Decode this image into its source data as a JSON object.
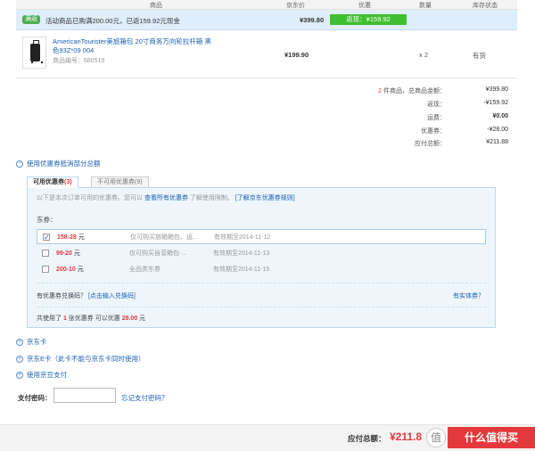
{
  "header": {
    "col_product": "商品",
    "col_jd_price": "京东价",
    "col_discount": "优惠",
    "col_qty": "数量",
    "col_stock": "库存状态"
  },
  "promo": {
    "badge": "满返",
    "text": "活动商品已购满200.00元，已返159.92元现金",
    "price": "¥399.80",
    "rebate_label": "返现：¥159.92"
  },
  "product": {
    "name": "AmericanTourister美旅箱包 20寸商务万向轮拉杆箱 黑色93Z*09 004",
    "code_label": "商品编号：",
    "code": "680515",
    "price": "¥199.90",
    "qty": "x 2",
    "stock": "有货"
  },
  "summary": {
    "count": "2",
    "count_label": " 件商品，总商品金额：",
    "total_goods": "¥399.80",
    "rebate_label": "返现：",
    "rebate": "-¥159.92",
    "shipping_label": "运费：",
    "shipping": "¥0.00",
    "coupon_label": "优惠券：",
    "coupon": "-¥28.00",
    "due_label": "应付总额：",
    "due": "¥211.88"
  },
  "coupon_toggle": "使用优惠券抵消部分总额",
  "tabs": {
    "available": "可用优惠券",
    "available_count": "(3)",
    "unavailable": "不可用优惠券(9)"
  },
  "panel": {
    "note": "以下是本次订单可用的优惠券。您可以",
    "note_link1": "查看所有优惠券",
    "note_mid": "了解使用限制。",
    "note_link2": "[了解京东优惠券规则]",
    "subtitle": "东券：",
    "coupons": [
      {
        "amount": "158-28",
        "unit": "元",
        "scope": "仅可购买旅箱箱包、运...",
        "expiry": "有效期至2014-11-12",
        "checked": true
      },
      {
        "amount": "99-20",
        "unit": "元",
        "scope": "仅可购买自营箱包-...",
        "expiry": "有效期至2014-11-13",
        "checked": false
      },
      {
        "amount": "200-10",
        "unit": "元",
        "scope": "全品类东券",
        "expiry": "有效期至2014-11-15",
        "checked": false
      }
    ],
    "exchange_text": "有优惠券兑换码？",
    "exchange_link": "[点击输入兑换码]",
    "solid_coupon": "有实体券？",
    "used_prefix": "共使用了 ",
    "used_count": "1",
    "used_mid": " 张优惠券   可以优惠 ",
    "used_amount": "28.00",
    "used_suffix": " 元"
  },
  "options": {
    "jd_card": "京东卡",
    "jd_ecard": "京东E卡（此卡不能与京东卡同时使用）",
    "jd_beans": "使用京豆支付"
  },
  "payment": {
    "pwd_label": "支付密码：",
    "forgot": "忘记支付密码？"
  },
  "footer": {
    "total_label": "应付总额：",
    "total_value": "¥211.8",
    "submit": "什么值得买"
  }
}
